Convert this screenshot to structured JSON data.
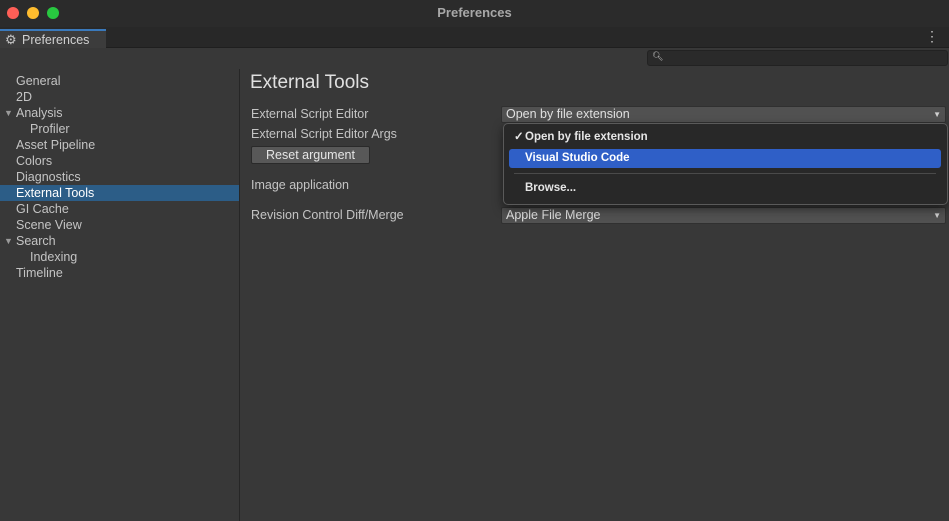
{
  "window": {
    "title": "Preferences"
  },
  "tab": {
    "label": "Preferences",
    "icon": "gear-icon"
  },
  "search": {
    "placeholder": ""
  },
  "sidebar": {
    "items": [
      {
        "label": "General",
        "indent": 0,
        "selected": false
      },
      {
        "label": "2D",
        "indent": 0,
        "selected": false
      },
      {
        "label": "Analysis",
        "indent": 0,
        "expanded": true,
        "selected": false
      },
      {
        "label": "Profiler",
        "indent": 1,
        "selected": false
      },
      {
        "label": "Asset Pipeline",
        "indent": 0,
        "selected": false
      },
      {
        "label": "Colors",
        "indent": 0,
        "selected": false
      },
      {
        "label": "Diagnostics",
        "indent": 0,
        "selected": false
      },
      {
        "label": "External Tools",
        "indent": 0,
        "selected": true
      },
      {
        "label": "GI Cache",
        "indent": 0,
        "selected": false
      },
      {
        "label": "Scene View",
        "indent": 0,
        "selected": false
      },
      {
        "label": "Search",
        "indent": 0,
        "expanded": true,
        "selected": false
      },
      {
        "label": "Indexing",
        "indent": 1,
        "selected": false
      },
      {
        "label": "Timeline",
        "indent": 0,
        "selected": false
      }
    ]
  },
  "main": {
    "title": "External Tools",
    "external_script_editor": {
      "label": "External Script Editor",
      "value": "Open by file extension"
    },
    "external_script_editor_args": {
      "label": "External Script Editor Args"
    },
    "reset_button": "Reset argument",
    "image_application": {
      "label": "Image application"
    },
    "revision_control": {
      "label": "Revision Control Diff/Merge",
      "value": "Apple File Merge"
    }
  },
  "popup": {
    "items": [
      {
        "label": "Open by file extension",
        "checked": true,
        "highlighted": false
      },
      {
        "label": "Visual Studio Code",
        "checked": false,
        "highlighted": true
      },
      {
        "label": "Browse...",
        "checked": false,
        "highlighted": false
      }
    ],
    "check_glyph": "✓"
  },
  "colors": {
    "selection": "#2c5d87",
    "popup_highlight": "#2f5fc7",
    "background": "#383838"
  }
}
